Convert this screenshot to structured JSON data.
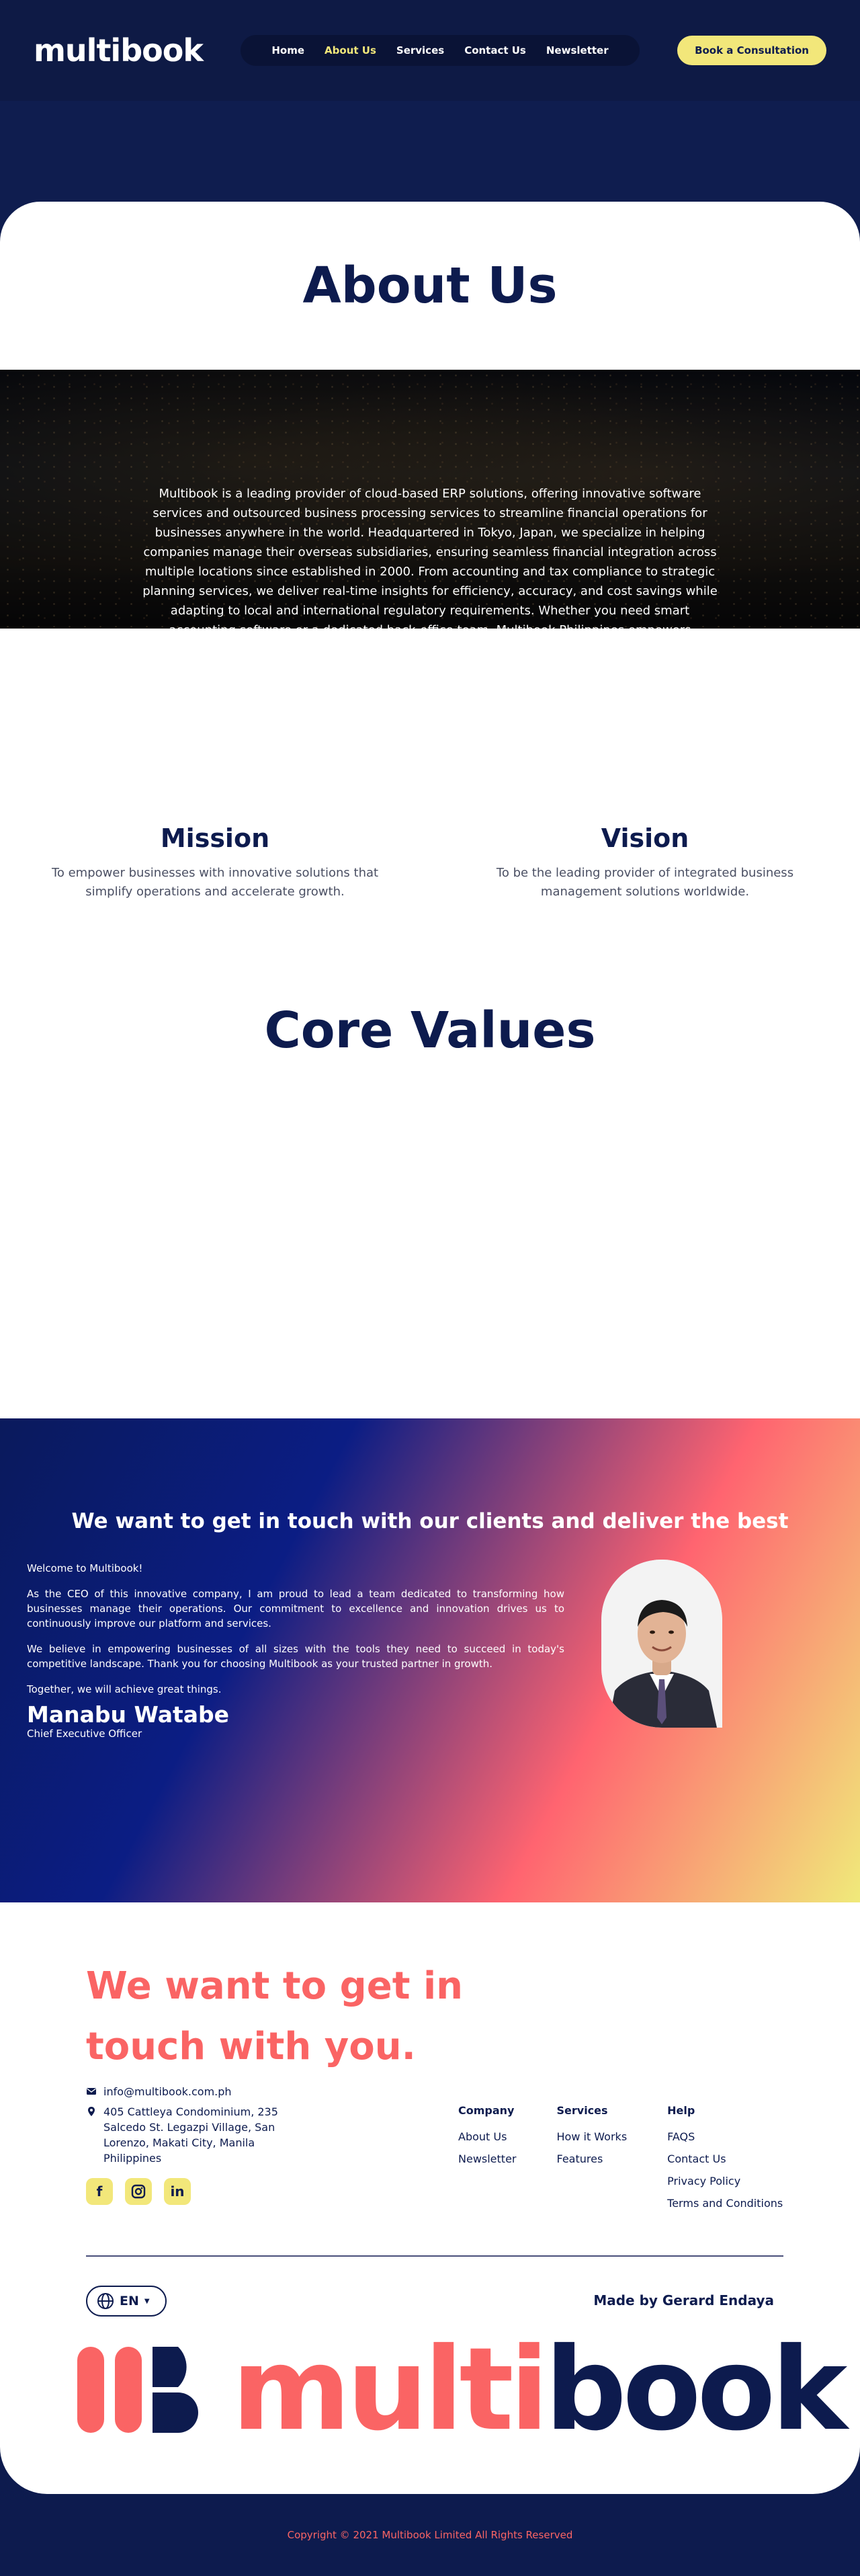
{
  "brand": {
    "logo_text": "multibook"
  },
  "nav": {
    "items": [
      {
        "label": "Home",
        "active": false
      },
      {
        "label": "About Us",
        "active": true
      },
      {
        "label": "Services",
        "active": false
      },
      {
        "label": "Contact Us",
        "active": false
      },
      {
        "label": "Newsletter",
        "active": false
      }
    ],
    "cta_label": "Book a Consultation"
  },
  "about": {
    "title": "About Us",
    "text": "Multibook is a leading provider of cloud-based ERP solutions, offering innovative software services and outsourced business processing services to streamline financial operations for businesses anywhere in the world. Headquartered in Tokyo, Japan, we specialize in helping companies manage their overseas subsidiaries, ensuring seamless financial integration across multiple locations since established in 2000. From accounting and tax compliance to strategic planning services, we deliver real-time insights for efficiency, accuracy, and cost savings while adapting to local and international regulatory requirements. Whether you need smart accounting software or a dedicated back-office team, Multibook Philippines empowers businesses with technology-driven financial expertise."
  },
  "mission": {
    "title": "Mission",
    "text": "To empower businesses with innovative solutions that simplify operations and accelerate growth."
  },
  "vision": {
    "title": "Vision",
    "text": "To be the leading provider of integrated business management solutions worldwide."
  },
  "core_values": {
    "title": "Core Values"
  },
  "ceo": {
    "heading": "We want to get in touch with our clients and deliver the best",
    "greeting": "Welcome to Multibook!",
    "paragraph1": "As the CEO of this innovative company, I am proud to lead a team dedicated to transforming how businesses manage their operations. Our commitment to excellence and innovation drives us to continuously improve our platform and services.",
    "paragraph2": "We believe in empowering businesses of all sizes with the tools they need to succeed in today's competitive landscape. Thank you for choosing Multibook as your trusted partner in growth.",
    "closing": "Together, we will achieve great things.",
    "name": "Manabu Watabe",
    "role": "Chief Executive Officer"
  },
  "footer": {
    "title": "We want to get in touch with you.",
    "email": "info@multibook.com.ph",
    "address": "405 Cattleya Condominium, 235 Salcedo St. Legazpi Village, San Lorenzo, Makati City, Manila Philippines",
    "socials": [
      "facebook-icon",
      "instagram-icon",
      "linkedin-icon"
    ],
    "columns": [
      {
        "title": "Company",
        "links": [
          "About Us",
          "Newsletter"
        ]
      },
      {
        "title": "Services",
        "links": [
          "How it Works",
          "Features"
        ]
      },
      {
        "title": "Help",
        "links": [
          "FAQS",
          "Contact Us",
          "Privacy Policy",
          "Terms and Conditions"
        ]
      }
    ],
    "language": "EN",
    "made_by": "Made by Gerard Endaya",
    "big_logo": {
      "part1": "multi",
      "part2": "book"
    },
    "copyright": "Copyright © 2021 Multibook Limited All Rights Reserved"
  },
  "colors": {
    "navy": "#0d1b4e",
    "accent_yellow": "#f2e77a",
    "coral": "#fa6464"
  }
}
